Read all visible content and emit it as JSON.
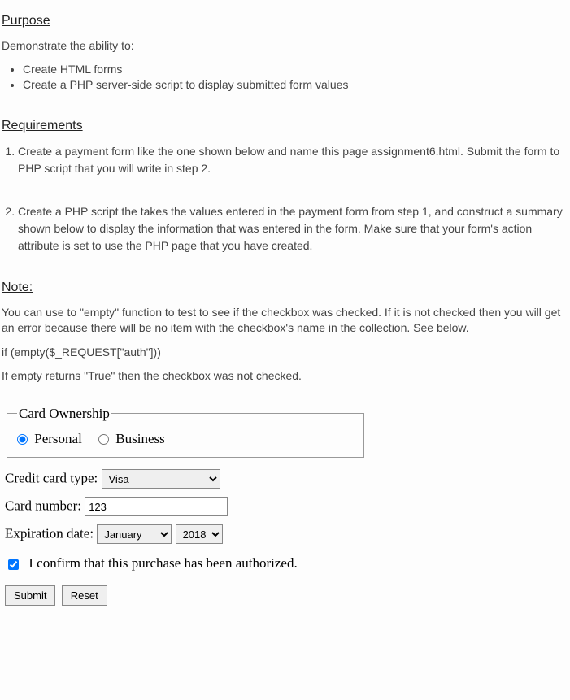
{
  "purpose": {
    "heading": "Purpose",
    "intro": "Demonstrate the ability to:",
    "items": [
      "Create HTML forms",
      "Create a PHP server-side script to display submitted form values"
    ]
  },
  "requirements": {
    "heading": "Requirements",
    "items": [
      "Create a payment form like the one shown below and name this page assignment6.html.  Submit the form to PHP script that you will write in step 2.",
      "Create a PHP script the takes the values entered in the payment form from step 1, and construct a summary shown below to display the information that was entered in the form.  Make sure that your form's action attribute is set to use the PHP page that you have created."
    ]
  },
  "note": {
    "heading": "Note:",
    "p1": "You can use to \"empty\" function to test to see if the checkbox was checked.  If it is not checked then you will get an error because there will be no item with the checkbox's name in the collection.  See below.",
    "code": "if (empty($_REQUEST[\"auth\"]))",
    "p2": "If empty returns \"True\" then the checkbox was not checked."
  },
  "form": {
    "legend": "Card Ownership",
    "radio_personal": "Personal",
    "radio_business": "Business",
    "card_type_label": "Credit card type:",
    "card_type_value": "Visa",
    "card_number_label": "Card number:",
    "card_number_value": "123",
    "exp_label": "Expiration date:",
    "exp_month": "January",
    "exp_year": "2018",
    "confirm_label": "I confirm that this purchase has been authorized.",
    "submit": "Submit",
    "reset": "Reset"
  }
}
